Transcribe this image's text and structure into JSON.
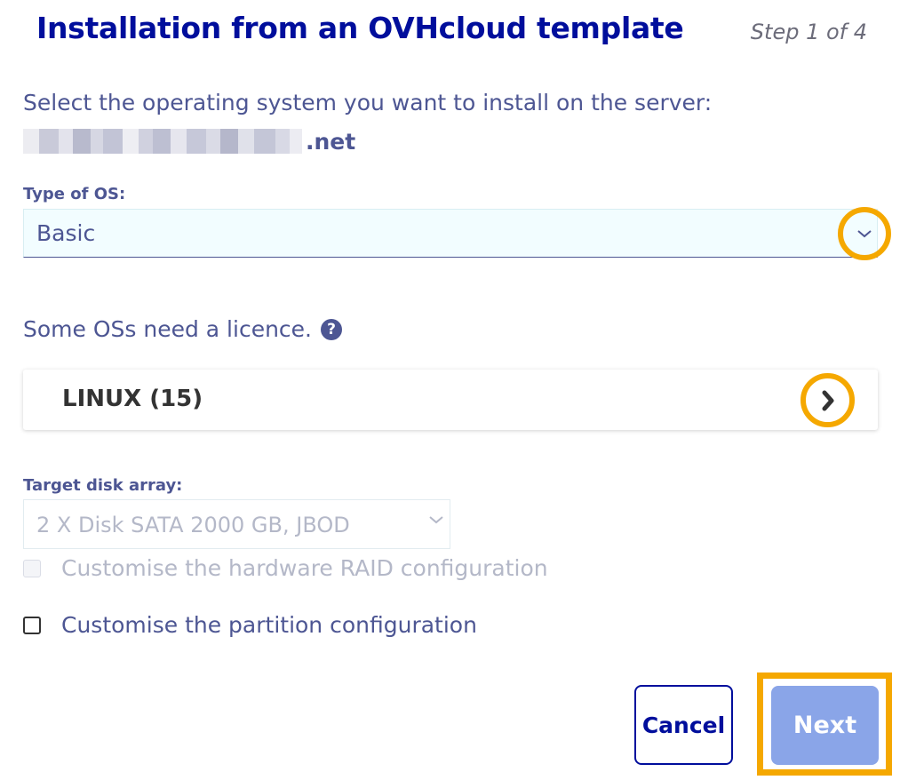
{
  "header": {
    "title": "Installation from an OVHcloud template",
    "step": "Step 1 of 4"
  },
  "prompt": "Select the operating system you want to install on the server:",
  "server": {
    "name_suffix": ".net"
  },
  "os_type": {
    "label": "Type of OS:",
    "value": "Basic"
  },
  "licence": {
    "text": "Some OSs need a licence.",
    "help_icon": "?"
  },
  "os_group": {
    "label": "LINUX (15)"
  },
  "disk": {
    "label": "Target disk array:",
    "value": "2 X Disk SATA 2000 GB, JBOD"
  },
  "options": {
    "raid": "Customise the hardware RAID configuration",
    "partition": "Customise the partition configuration"
  },
  "buttons": {
    "cancel": "Cancel",
    "next": "Next"
  },
  "colors": {
    "title": "#000e9c",
    "text": "#4d5693",
    "highlight": "#f5a800",
    "next_button": "#8aa5e8",
    "select_bg": "#f2fdff"
  }
}
